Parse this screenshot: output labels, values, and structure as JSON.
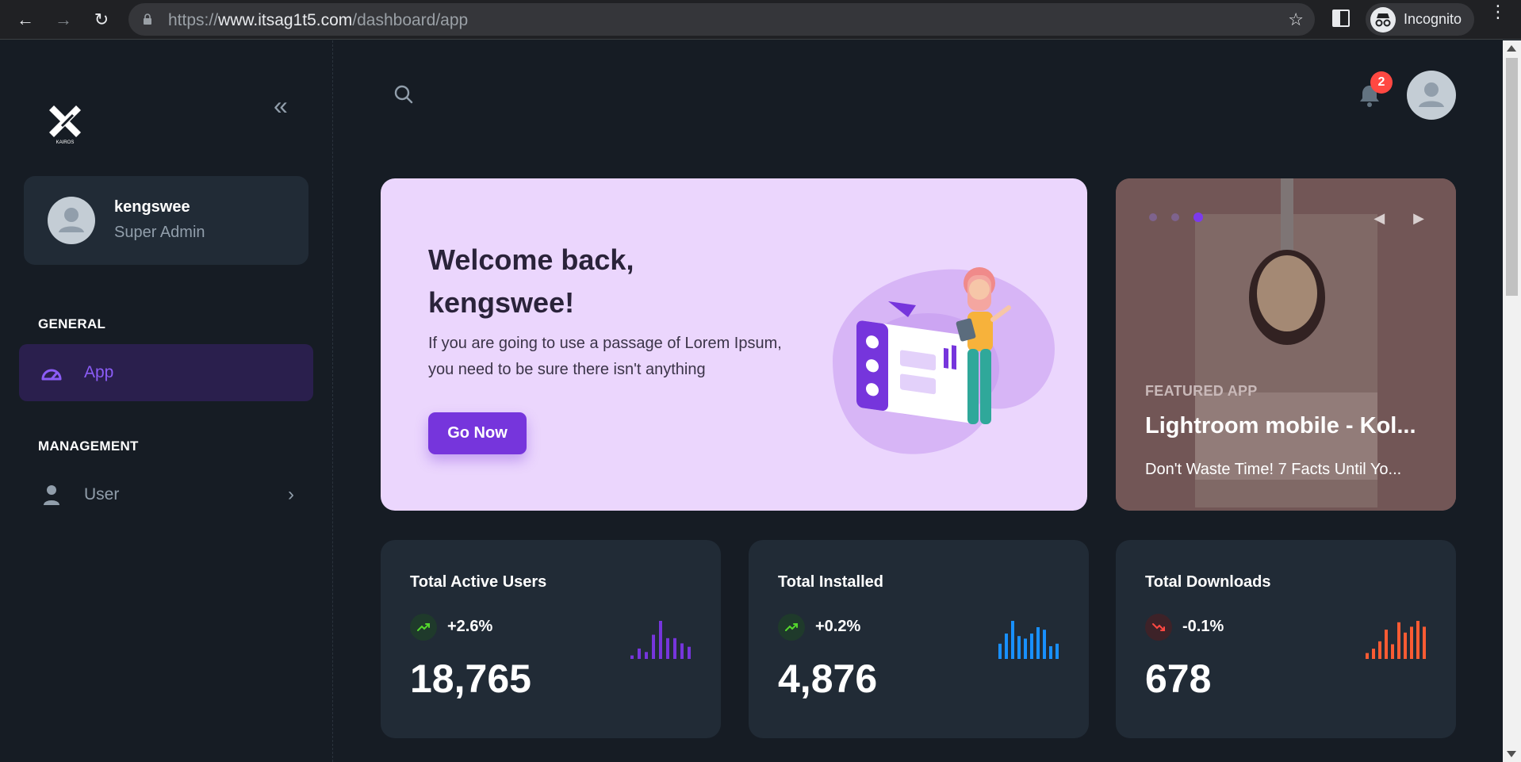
{
  "browser": {
    "url_prefix": "https://",
    "url_domain": "www.itsag1t5.com",
    "url_path": "/dashboard/app",
    "profile_label": "Incognito"
  },
  "sidebar": {
    "logo_text": "KAIROS",
    "user": {
      "name": "kengswee",
      "role": "Super Admin"
    },
    "sections": [
      {
        "title": "GENERAL",
        "items": [
          {
            "label": "App",
            "icon": "dashboard-icon",
            "active": true
          }
        ]
      },
      {
        "title": "MANAGEMENT",
        "items": [
          {
            "label": "User",
            "icon": "user-icon",
            "active": false,
            "has_submenu": true
          }
        ]
      }
    ]
  },
  "header": {
    "notification_count": "2"
  },
  "welcome": {
    "title": "Welcome back, kengswee!",
    "text": "If you are going to use a passage of Lorem Ipsum, you need to be sure there isn't anything",
    "button": "Go Now"
  },
  "featured": {
    "tag": "FEATURED APP",
    "title": "Lightroom mobile - Kol...",
    "description": "Don't Waste Time! 7 Facts Until Yo...",
    "slide_index": 3,
    "slide_count": 3
  },
  "stats": [
    {
      "title": "Total Active Users",
      "percent": "+2.6%",
      "trend": "up",
      "value": "18,765",
      "color": "#7635dc",
      "spark": [
        2,
        6,
        4,
        14,
        22,
        12,
        12,
        9,
        7
      ]
    },
    {
      "title": "Total Installed",
      "percent": "+0.2%",
      "trend": "up",
      "value": "4,876",
      "color": "#1890ff",
      "spark": [
        12,
        20,
        30,
        18,
        16,
        20,
        25,
        23,
        10,
        12
      ]
    },
    {
      "title": "Total Downloads",
      "percent": "-0.1%",
      "trend": "down",
      "value": "678",
      "color": "#fa5b33",
      "spark": [
        4,
        7,
        12,
        20,
        10,
        25,
        18,
        22,
        26,
        22
      ]
    }
  ],
  "colors": {
    "accent": "#7635dc",
    "bg": "#161c24",
    "card": "#212b36",
    "welcome_bg": "#ebd6fd",
    "badge": "#ff4842"
  }
}
